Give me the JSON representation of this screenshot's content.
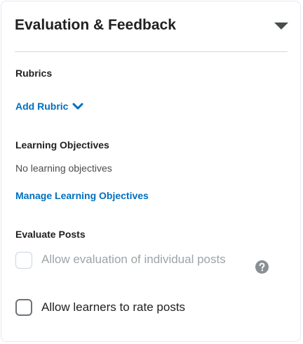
{
  "panel": {
    "title": "Evaluation & Feedback",
    "collapse_icon": "caret-down-icon"
  },
  "rubrics": {
    "heading": "Rubrics",
    "add_link": "Add Rubric",
    "add_icon": "chevron-down-icon"
  },
  "learning_objectives": {
    "heading": "Learning Objectives",
    "empty_text": "No learning objectives",
    "manage_link": "Manage Learning Objectives"
  },
  "evaluate_posts": {
    "heading": "Evaluate Posts",
    "options": [
      {
        "label": "Allow evaluation of individual posts",
        "checked": false,
        "disabled": true
      },
      {
        "label": "Allow learners to rate posts",
        "checked": false,
        "disabled": false
      }
    ],
    "help_icon": "question-circle-icon"
  },
  "colors": {
    "link": "#006fbf",
    "text": "#202122",
    "muted": "#9ea4a8",
    "border": "#e3e9f1"
  }
}
